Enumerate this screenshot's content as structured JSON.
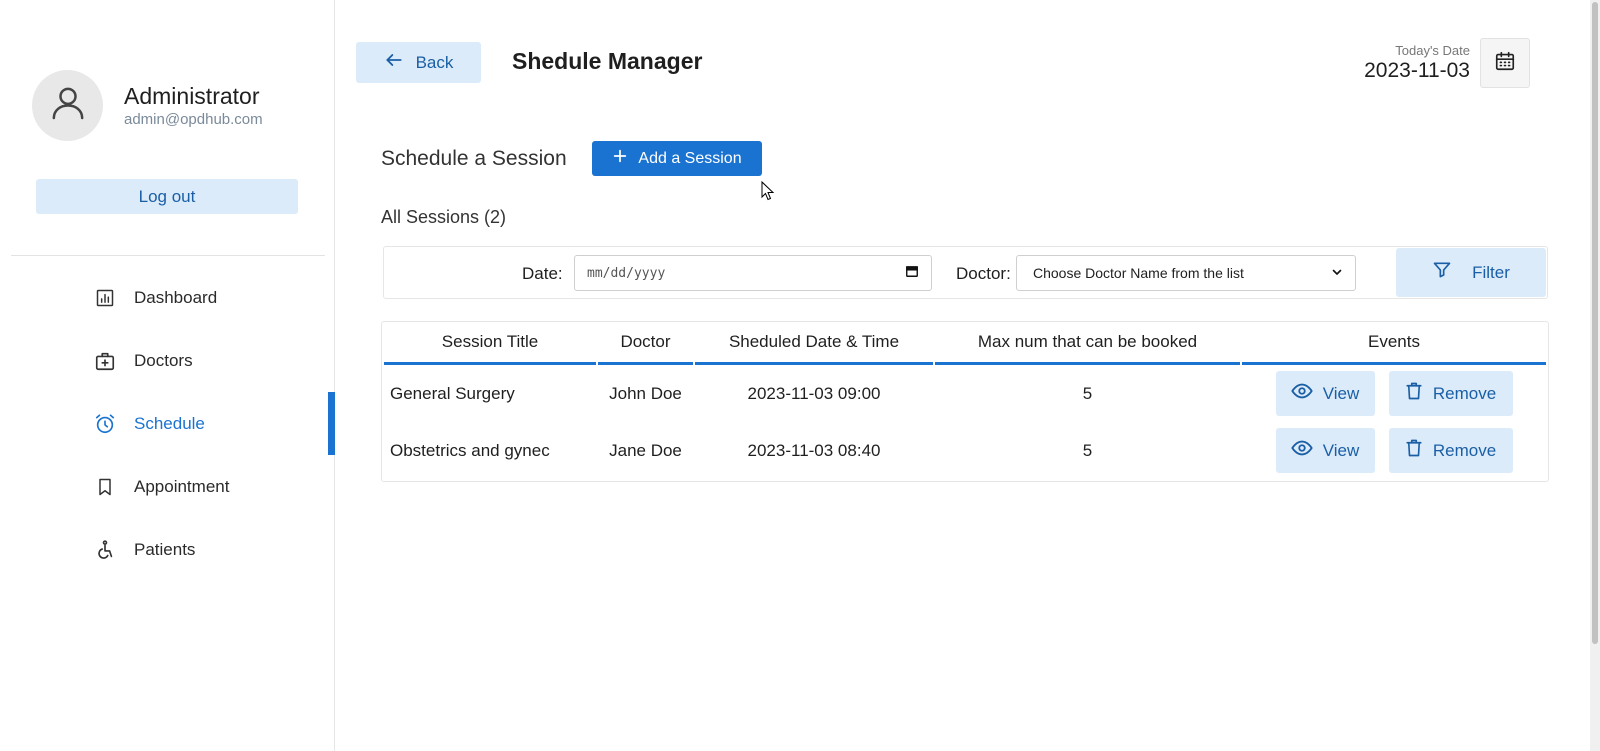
{
  "sidebar": {
    "user_name": "Administrator",
    "user_email": "admin@opdhub.com",
    "logout_label": "Log out",
    "items": [
      {
        "label": "Dashboard",
        "icon": "dashboard-icon"
      },
      {
        "label": "Doctors",
        "icon": "doctor-bag-icon"
      },
      {
        "label": "Schedule",
        "icon": "alarm-clock-icon",
        "active": true
      },
      {
        "label": "Appointment",
        "icon": "bookmark-icon"
      },
      {
        "label": "Patients",
        "icon": "wheelchair-icon"
      }
    ]
  },
  "header": {
    "back_label": "Back",
    "title": "Shedule Manager",
    "today_label": "Today's Date",
    "today_value": "2023-11-03"
  },
  "schedule": {
    "heading": "Schedule a Session",
    "add_label": "Add a Session",
    "all_sessions_label": "All Sessions (2)"
  },
  "filter": {
    "date_label": "Date:",
    "date_placeholder": "mm/dd/yyyy",
    "doctor_label": "Doctor:",
    "doctor_selected": "Choose Doctor Name from the list",
    "filter_label": "Filter"
  },
  "table": {
    "columns": [
      "Session Title",
      "Doctor",
      "Sheduled Date & Time",
      "Max num that can be booked",
      "Events"
    ],
    "rows": [
      {
        "title": "General Surgery",
        "doctor": "John Doe",
        "datetime": "2023-11-03 09:00",
        "max": "5"
      },
      {
        "title": "Obstetrics and gynec",
        "doctor": "Jane Doe",
        "datetime": "2023-11-03 08:40",
        "max": "5"
      }
    ],
    "view_label": "View",
    "remove_label": "Remove"
  },
  "colors": {
    "accent": "#1a73d1",
    "light_button": "#dcebf9",
    "light_button_text": "#1a5fa6"
  }
}
